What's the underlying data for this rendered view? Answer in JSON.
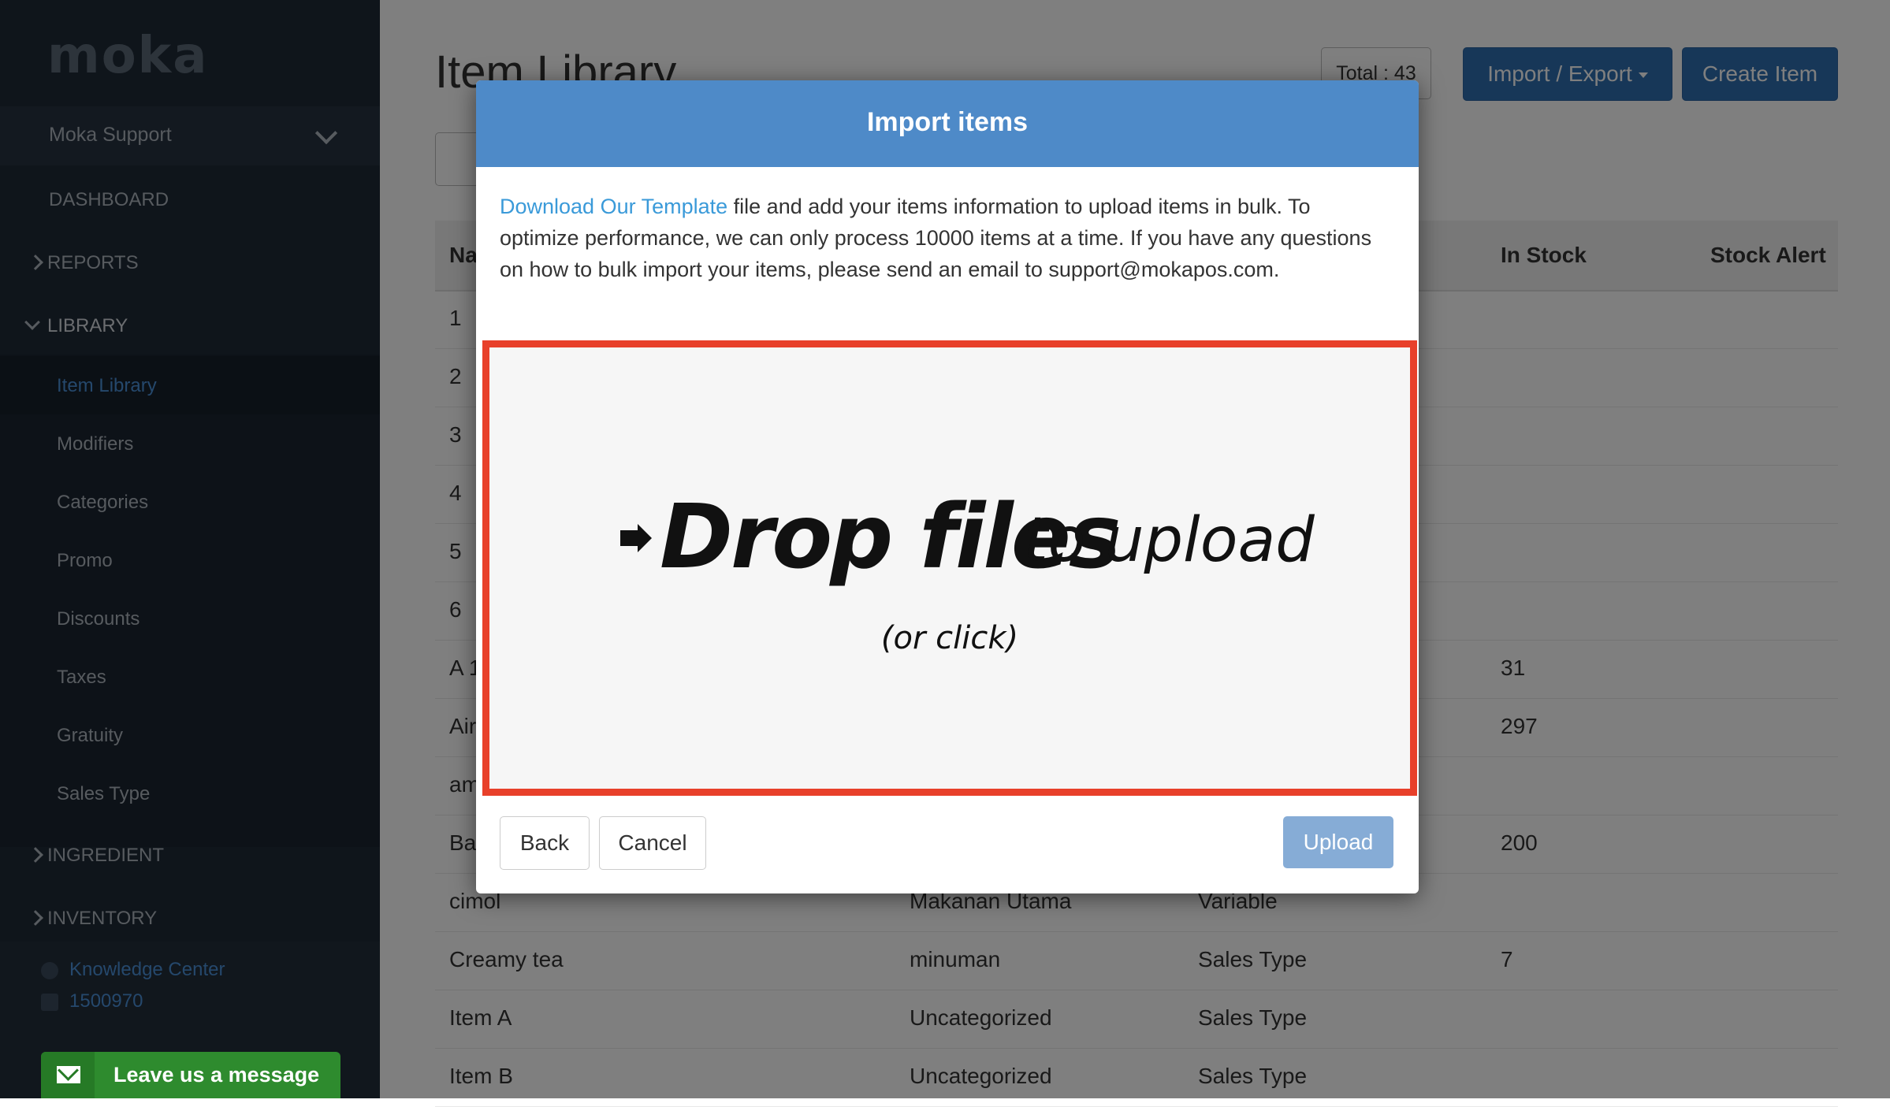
{
  "sidebar": {
    "logo": "moka",
    "account": "Moka Support",
    "dashboard": "DASHBOARD",
    "reports": "REPORTS",
    "library": "LIBRARY",
    "library_items": [
      "Item Library",
      "Modifiers",
      "Categories",
      "Promo",
      "Discounts",
      "Taxes",
      "Gratuity",
      "Sales Type"
    ],
    "ingredient": "INGREDIENT",
    "inventory": "INVENTORY",
    "knowledge_center": "Knowledge Center",
    "phone": "1500970",
    "leave_message": "Leave us a message"
  },
  "main": {
    "title": "Item Library",
    "total": "Total : 43",
    "import_export": "Import / Export",
    "create_item": "Create Item",
    "columns": [
      "Na",
      "In Stock",
      "Stock Alert"
    ],
    "rows": [
      {
        "name": "1",
        "category": "",
        "type": "",
        "stock": ""
      },
      {
        "name": "2",
        "category": "",
        "type": "",
        "stock": ""
      },
      {
        "name": "3",
        "category": "",
        "type": "",
        "stock": ""
      },
      {
        "name": "4",
        "category": "",
        "type": "",
        "stock": ""
      },
      {
        "name": "5",
        "category": "",
        "type": "",
        "stock": ""
      },
      {
        "name": "6",
        "category": "",
        "type": "",
        "stock": ""
      },
      {
        "name": "A 1",
        "category": "",
        "type": "",
        "stock": "31"
      },
      {
        "name": "Air",
        "category": "",
        "type": "",
        "stock": "297"
      },
      {
        "name": "am",
        "category": "",
        "type": "",
        "stock": ""
      },
      {
        "name": "Ba",
        "category": "",
        "type": "",
        "stock": "200"
      },
      {
        "name": "cimol",
        "category": "Makanan Utama",
        "type": "Variable",
        "stock": ""
      },
      {
        "name": "Creamy tea",
        "category": "minuman",
        "type": "Sales Type",
        "stock": "7"
      },
      {
        "name": "Item A",
        "category": "Uncategorized",
        "type": "Sales Type",
        "stock": ""
      },
      {
        "name": "Item B",
        "category": "Uncategorized",
        "type": "Sales Type",
        "stock": ""
      }
    ]
  },
  "modal": {
    "title": "Import items",
    "template_link": "Download Our Template",
    "body_text": " file and add your items information to upload items in bulk. To optimize performance, we can only process 10000 items at a time. If you have any questions on how to bulk import your items, please send an email to support@mokapos.com.",
    "drop_bold": "Drop files",
    "drop_light": "to upload",
    "drop_sub": "(or click)",
    "back": "Back",
    "cancel": "Cancel",
    "upload": "Upload"
  },
  "colors": {
    "sidebar_bg": "#1f2a37",
    "accent": "#2f6fb0",
    "modal_header": "#4e8ac8",
    "dropzone_border": "#e8402a",
    "leave_message_bg": "#2e8b2e"
  }
}
